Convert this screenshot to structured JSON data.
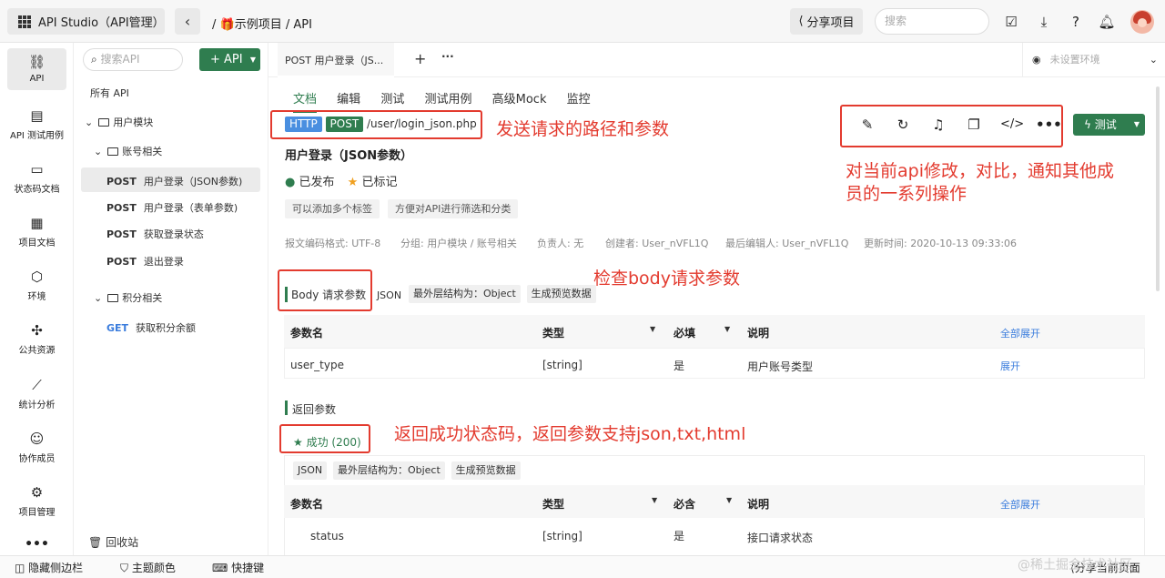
{
  "header": {
    "app_title": "API Studio（API管理）",
    "breadcrumb": "/ 🎁示例项目 / API",
    "share_label": "分享项目",
    "search_placeholder": "搜索"
  },
  "nav": [
    {
      "label": "API",
      "icon": "link-icon"
    },
    {
      "label": "API 测试用例",
      "icon": "clipboard-icon"
    },
    {
      "label": "状态码文档",
      "icon": "doc-icon"
    },
    {
      "label": "项目文档",
      "icon": "list-icon"
    },
    {
      "label": "环境",
      "icon": "cube-icon"
    },
    {
      "label": "公共资源",
      "icon": "puzzle-icon"
    },
    {
      "label": "统计分析",
      "icon": "chart-icon"
    },
    {
      "label": "协作成员",
      "icon": "user-icon"
    },
    {
      "label": "项目管理",
      "icon": "gear-icon"
    }
  ],
  "tree": {
    "search_placeholder": "搜索API",
    "add_label": "+ API",
    "all_label": "所有 API",
    "folder_user": "用户模块",
    "folder_account": "账号相关",
    "items_account": [
      {
        "method": "POST",
        "name": "用户登录（JSON参数)"
      },
      {
        "method": "POST",
        "name": "用户登录（表单参数)"
      },
      {
        "method": "POST",
        "name": "获取登录状态"
      },
      {
        "method": "POST",
        "name": "退出登录"
      }
    ],
    "folder_points": "积分相关",
    "items_points": [
      {
        "method": "GET",
        "name": "获取积分余额"
      }
    ],
    "recycle": "回收站"
  },
  "tabs": {
    "active_tab": "POST 用户登录（JS...",
    "env_placeholder": "未设置环境"
  },
  "subtabs": [
    "文档",
    "编辑",
    "测试",
    "测试用例",
    "高级Mock",
    "监控"
  ],
  "api": {
    "protocol": "HTTP",
    "method": "POST",
    "path": "/user/login_json.php",
    "title": "用户登录（JSON参数）",
    "status": "已发布",
    "marked": "已标记",
    "tag1": "可以添加多个标签",
    "tag2": "方便对API进行筛选和分类",
    "meta": [
      "报文编码格式: UTF-8",
      "分组: 用户模块 / 账号相关",
      "负责人: 无",
      "创建者: User_nVFL1Q",
      "最后编辑人: User_nVFL1Q",
      "更新时间: 2020-10-13 09:33:06"
    ],
    "test_label": "测试"
  },
  "body_section": {
    "title": "Body 请求参数",
    "format": "JSON",
    "outer": "最外层结构为：Object",
    "preview": "生成预览数据",
    "headers": [
      "参数名",
      "类型",
      "必填",
      "说明"
    ],
    "expand_all": "全部展开",
    "row": {
      "name": "user_type",
      "type": "[string]",
      "required": "是",
      "desc": "用户账号类型",
      "action": "展开"
    }
  },
  "return_section": {
    "title": "返回参数",
    "success": "成功 (200)",
    "format": "JSON",
    "outer": "最外层结构为：Object",
    "preview": "生成预览数据",
    "headers": [
      "参数名",
      "类型",
      "必含",
      "说明"
    ],
    "expand_all": "全部展开",
    "row": {
      "name": "status",
      "type": "[string]",
      "required": "是",
      "desc": "接口请求状态"
    }
  },
  "annotations": {
    "a1": "发送请求的路径和参数",
    "a2_line1": "对当前api修改，对比，通知其他成",
    "a2_line2": "员的一系列操作",
    "a3": "检查body请求参数",
    "a4": "返回成功状态码，返回参数支持json,txt,html"
  },
  "bottom": {
    "hide_sidebar": "隐藏侧边栏",
    "theme": "主题颜色",
    "shortcut": "快捷键",
    "share_page": "分享当前页面",
    "watermark": "@稀土掘金技术社区"
  },
  "colors": {
    "accent": "#2f7d4f",
    "http_tag": "#4a8fe0",
    "annotation": "#e33b2f",
    "link": "#3b7ddd"
  }
}
